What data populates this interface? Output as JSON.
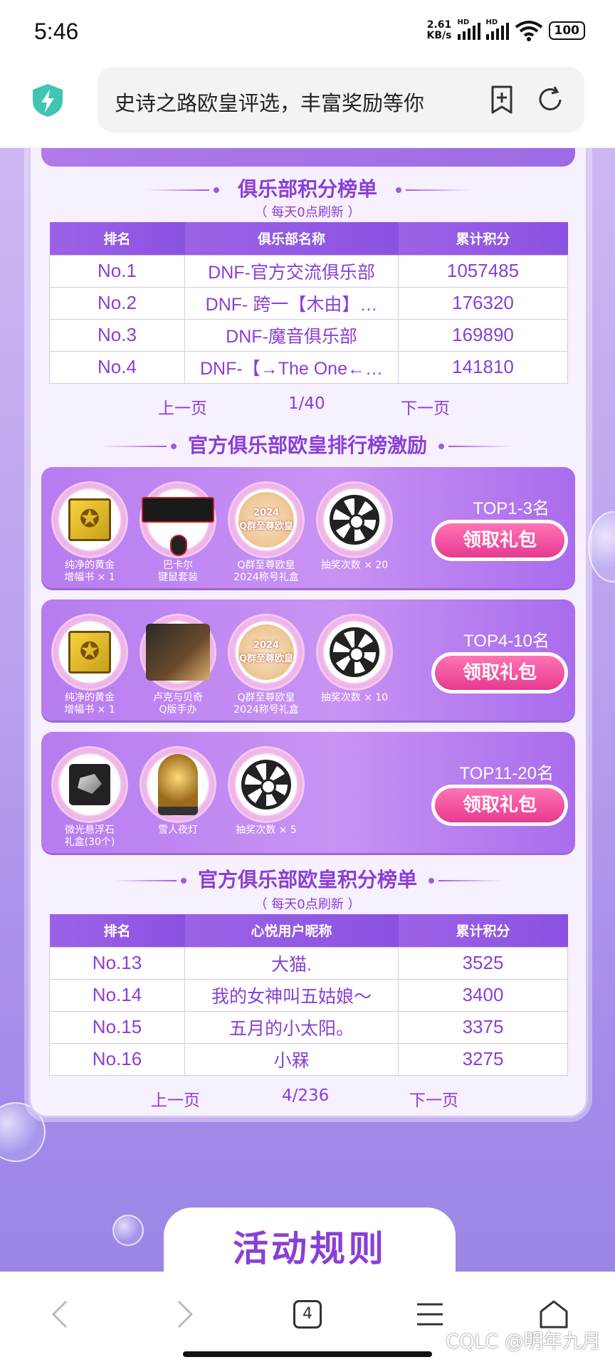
{
  "status_bar": {
    "time": "5:46",
    "net_speed_value": "2.61",
    "net_speed_unit": "KB/s",
    "sig1_label": "HD",
    "sig2_label": "HD",
    "battery": "100"
  },
  "browser": {
    "url_title": "史诗之路欧皇评选，丰富奖励等你"
  },
  "club_board": {
    "title": "俱乐部积分榜单",
    "subtitle": "（ 每天0点刷新 ）",
    "headers": [
      "排名",
      "俱乐部名称",
      "累计积分"
    ],
    "rows": [
      {
        "rank": "No.1",
        "name": "DNF-官方交流俱乐部",
        "score": "1057485"
      },
      {
        "rank": "No.2",
        "name": "DNF- 跨一【木由】…",
        "score": "176320"
      },
      {
        "rank": "No.3",
        "name": "DNF-魔音俱乐部",
        "score": "169890"
      },
      {
        "rank": "No.4",
        "name": "DNF-【→The One←…",
        "score": "141810"
      }
    ],
    "pager": {
      "prev": "上一页",
      "page": "1/40",
      "next": "下一页"
    }
  },
  "rewards": {
    "title": "官方俱乐部欧皇排行榜激励",
    "claim_label": "领取礼包",
    "tiers": [
      {
        "tier": "TOP1-3名",
        "items": [
          {
            "icon": "gold-book-icon",
            "label1": "纯净的黄金",
            "label2": "增幅书 × 1"
          },
          {
            "icon": "keyboard-mouse-icon",
            "label1": "巴卡尔",
            "label2": "键鼠套装"
          },
          {
            "icon": "title-badge-icon",
            "label1": "Q群至尊欧皇",
            "label2": "2024称号礼盒",
            "badge_year": "2024",
            "badge_text": "Q群至尊欧皇"
          },
          {
            "icon": "lottery-wheel-icon",
            "label1": "抽奖次数 × 20",
            "label2": ""
          }
        ]
      },
      {
        "tier": "TOP4-10名",
        "items": [
          {
            "icon": "gold-book-icon",
            "label1": "纯净的黄金",
            "label2": "增幅书 × 1"
          },
          {
            "icon": "figure-icon",
            "label1": "卢克与贝奇",
            "label2": "Q版手办"
          },
          {
            "icon": "title-badge-icon",
            "label1": "Q群至尊欧皇",
            "label2": "2024称号礼盒",
            "badge_year": "2024",
            "badge_text": "Q群至尊欧皇"
          },
          {
            "icon": "lottery-wheel-icon",
            "label1": "抽奖次数 × 10",
            "label2": ""
          }
        ]
      },
      {
        "tier": "TOP11-20名",
        "items": [
          {
            "icon": "stone-icon",
            "label1": "微光悬浮石",
            "label2": "礼盒(30个)"
          },
          {
            "icon": "snowman-lamp-icon",
            "label1": "雪人夜灯",
            "label2": ""
          },
          {
            "icon": "lottery-wheel-icon",
            "label1": "抽奖次数 × 5",
            "label2": ""
          }
        ]
      }
    ]
  },
  "user_board": {
    "title": "官方俱乐部欧皇积分榜单",
    "subtitle": "（ 每天0点刷新 ）",
    "headers": [
      "排名",
      "心悦用户昵称",
      "累计积分"
    ],
    "rows": [
      {
        "rank": "No.13",
        "name": "大猫.",
        "score": "3525"
      },
      {
        "rank": "No.14",
        "name": "我的女神叫五姑娘～",
        "score": "3400"
      },
      {
        "rank": "No.15",
        "name": "五月的小太阳。",
        "score": "3375"
      },
      {
        "rank": "No.16",
        "name": "小槑",
        "score": "3275"
      }
    ],
    "pager": {
      "prev": "上一页",
      "page": "4/236",
      "next": "下一页"
    }
  },
  "rules_banner": {
    "text": "活动规则"
  },
  "bottom_nav": {
    "tabs_count": "4",
    "watermark": "CQLC @明年九月"
  },
  "colors": {
    "accent": "#8a3fd6",
    "header": "#9d62e6",
    "claim": "#e63a8f"
  }
}
